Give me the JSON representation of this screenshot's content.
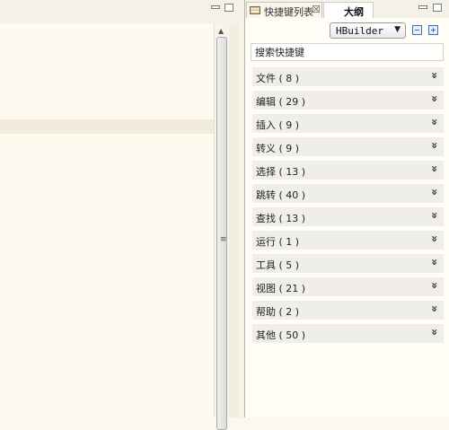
{
  "panel": {
    "tab_label": "快捷键列表",
    "tab_close": "☒",
    "tab_outline": "大纲",
    "scheme_value": "HBuilder",
    "search_placeholder": "搜索快捷键",
    "groups": [
      {
        "label": "文件 ( 8 )"
      },
      {
        "label": "编辑 ( 29 )"
      },
      {
        "label": "插入 ( 9 )"
      },
      {
        "label": "转义 ( 9 )"
      },
      {
        "label": "选择 ( 13 )"
      },
      {
        "label": "跳转 ( 40 )"
      },
      {
        "label": "查找 ( 13 )"
      },
      {
        "label": "运行 ( 1 )"
      },
      {
        "label": "工具 ( 5 )"
      },
      {
        "label": "视图 ( 21 )"
      },
      {
        "label": "帮助 ( 2 )"
      },
      {
        "label": "其他 ( 50 )"
      }
    ]
  },
  "icons": {
    "tab_icon": "keyboard-list-icon",
    "chevron": "double-chevron-down-icon"
  },
  "colors": {
    "background": "#fbf8ee",
    "group_bg": "#f0eee8",
    "accent": "#3b6fb6"
  }
}
